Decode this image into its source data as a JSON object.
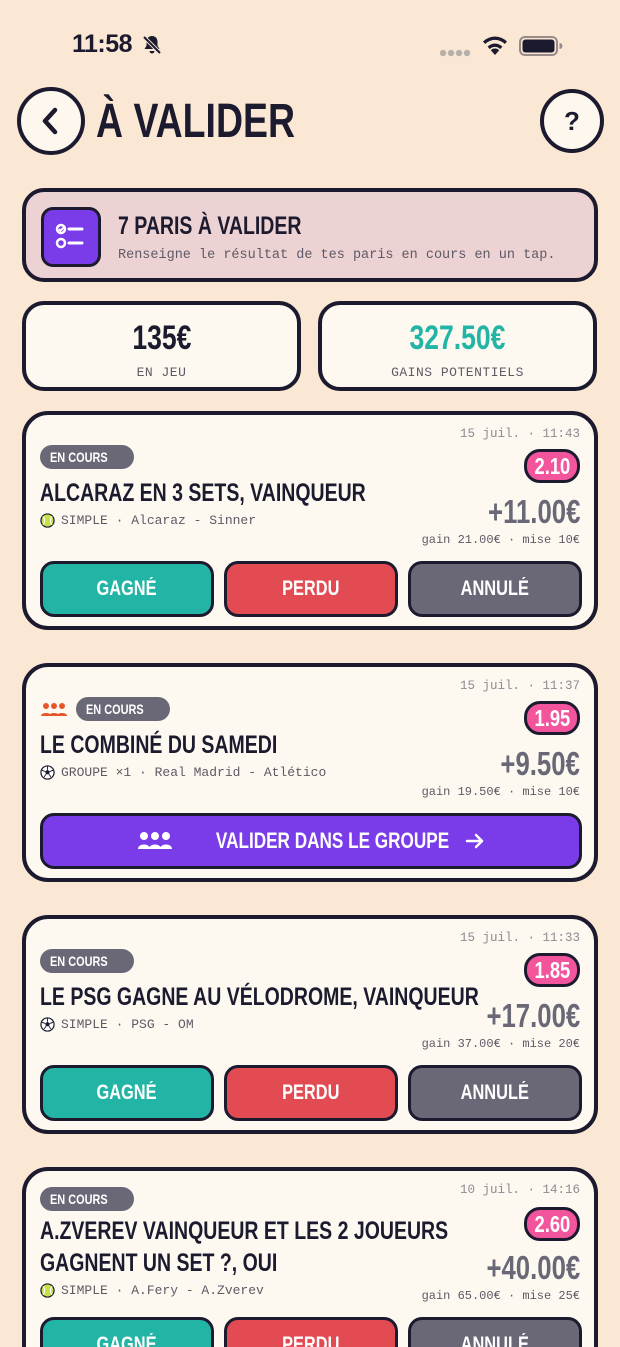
{
  "status_bar": {
    "time": "11:58"
  },
  "header": {
    "title": "À VALIDER",
    "help_label": "?"
  },
  "banner": {
    "title": "7 PARIS À VALIDER",
    "subtitle": "Renseigne le résultat de tes paris en cours en un tap."
  },
  "stats": {
    "stake": {
      "value": "135€",
      "label": "EN JEU"
    },
    "potential": {
      "value": "327.50€",
      "label": "GAINS POTENTIELS",
      "color": "#22B5A5"
    }
  },
  "bets": [
    {
      "date": "15 juil. · 11:43",
      "status": "EN COURS",
      "odds": "2.10",
      "title": "ALCARAZ EN 3 SETS, VAINQUEUR",
      "sport_icon": "tennis-ball-icon",
      "meta": "SIMPLE · Alcaraz - Sinner",
      "profit": "+11.00€",
      "gain_line": "gain 21.00€ · mise 10€",
      "buttons": {
        "won": "GAGNÉ",
        "lost": "PERDU",
        "void": "ANNULÉ"
      }
    },
    {
      "date": "15 juil. · 11:37",
      "status": "EN COURS",
      "odds": "1.95",
      "title": "LE COMBINÉ DU SAMEDI",
      "sport_icon": "soccer-ball-icon",
      "meta": "GROUPE ×1 · Real Madrid - Atlético",
      "profit": "+9.50€",
      "gain_line": "gain 19.50€ · mise 10€",
      "group_button": "VALIDER DANS LE GROUPE"
    },
    {
      "date": "15 juil. · 11:33",
      "status": "EN COURS",
      "odds": "1.85",
      "title": "LE PSG GAGNE AU VÉLODROME, VAINQUEUR",
      "sport_icon": "soccer-ball-icon",
      "meta": "SIMPLE · PSG - OM",
      "profit": "+17.00€",
      "gain_line": "gain 37.00€ · mise 20€",
      "buttons": {
        "won": "GAGNÉ",
        "lost": "PERDU",
        "void": "ANNULÉ"
      }
    },
    {
      "date": "10 juil. · 14:16",
      "status": "EN COURS",
      "odds": "2.60",
      "title_line1": "A.ZVEREV VAINQUEUR ET LES 2 JOUEURS",
      "title_line2": "GAGNENT UN SET ?, OUI",
      "sport_icon": "tennis-ball-icon",
      "meta": "SIMPLE · A.Fery - A.Zverev",
      "profit": "+40.00€",
      "gain_line": "gain 65.00€ · mise 25€",
      "buttons": {
        "won": "GAGNÉ",
        "lost": "PERDU",
        "void": "ANNULÉ"
      }
    }
  ]
}
